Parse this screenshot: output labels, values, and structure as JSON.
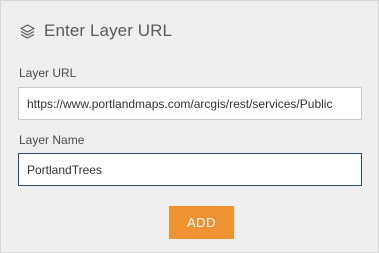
{
  "header": {
    "icon": "layers-icon",
    "title": "Enter Layer URL"
  },
  "form": {
    "url_label": "Layer URL",
    "url_value": "https://www.portlandmaps.com/arcgis/rest/services/Public",
    "name_label": "Layer Name",
    "name_value": "PortlandTrees"
  },
  "actions": {
    "add_label": "ADD"
  },
  "colors": {
    "accent": "#ee9232",
    "focus_border": "#2b4b78",
    "panel_bg": "#efefef"
  }
}
